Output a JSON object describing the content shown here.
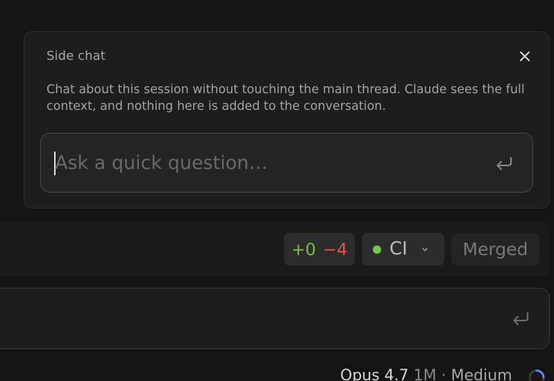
{
  "side_chat": {
    "title": "Side chat",
    "description": "Chat about this session without touching the main thread. Claude sees the full context, and nothing here is added to the conversation.",
    "input_placeholder": "Ask a quick question…",
    "input_value": "",
    "close_icon": "close-icon",
    "submit_icon": "enter-icon"
  },
  "status_strip": {
    "diff_added": "+0",
    "diff_removed": "−4",
    "ci_label": "CI",
    "ci_status_color": "#79c44b",
    "ci_chevron_icon": "chevron-down-icon",
    "merged_label": "Merged"
  },
  "composer": {
    "submit_icon": "enter-icon"
  },
  "model": {
    "name": "Opus 4.7",
    "context": "1M",
    "separator": "·",
    "effort": "Medium",
    "loading_icon": "spinner-icon"
  },
  "colors": {
    "background": "#141414",
    "panel": "#1d1d1d",
    "diff_add": "#7bbf4a",
    "diff_remove": "#e4574a",
    "spinner_accent": "#5b8ff0"
  }
}
